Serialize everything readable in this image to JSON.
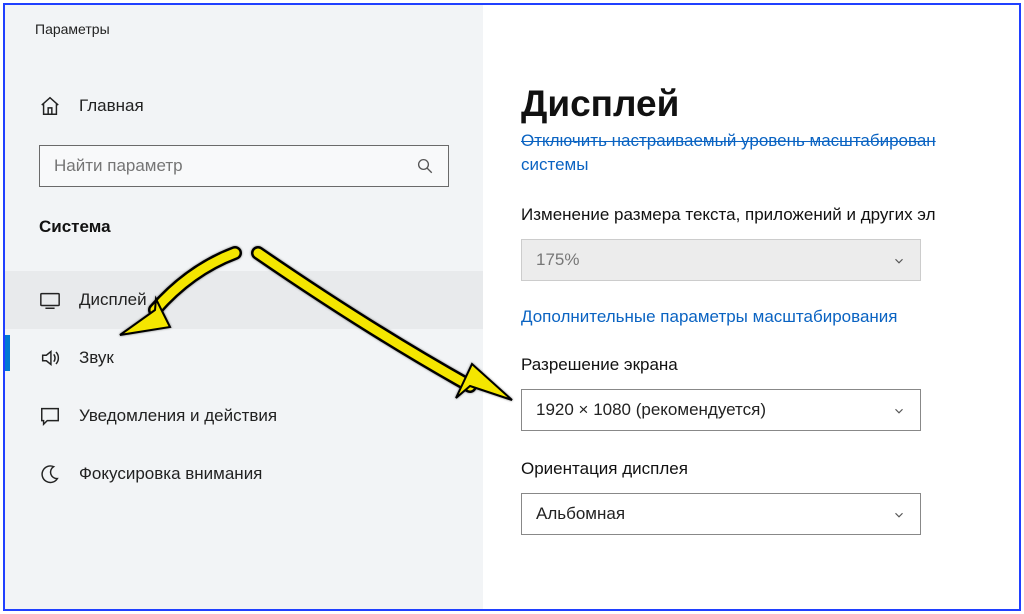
{
  "app_title": "Параметры",
  "sidebar": {
    "home_label": "Главная",
    "search_placeholder": "Найти параметр",
    "section_label": "Система",
    "items": [
      {
        "label": "Дисплей"
      },
      {
        "label": "Звук"
      },
      {
        "label": "Уведомления и действия"
      },
      {
        "label": "Фокусировка внимания"
      }
    ]
  },
  "main": {
    "heading": "Дисплей",
    "link_line1": "Отключить настраиваемый уровень масштабирован",
    "link_line2": "системы",
    "text_size_label": "Изменение размера текста, приложений и других эл",
    "scale_value": "175%",
    "advanced_link": "Дополнительные параметры масштабирования",
    "resolution_label": "Разрешение экрана",
    "resolution_value": "1920 × 1080 (рекомендуется)",
    "orientation_label": "Ориентация дисплея",
    "orientation_value": "Альбомная"
  }
}
